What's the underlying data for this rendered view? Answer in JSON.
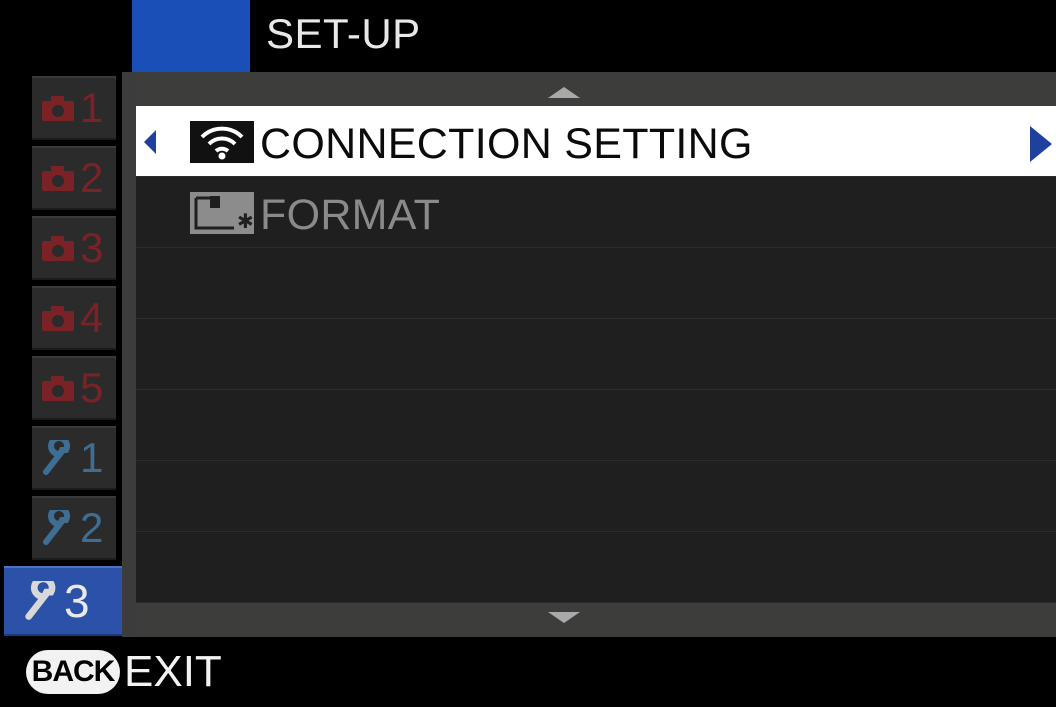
{
  "header": {
    "title": "SET-UP"
  },
  "sidebar": {
    "items": [
      {
        "icon": "camera-icon",
        "number": "1",
        "kind": "shooting"
      },
      {
        "icon": "camera-icon",
        "number": "2",
        "kind": "shooting"
      },
      {
        "icon": "camera-icon",
        "number": "3",
        "kind": "shooting"
      },
      {
        "icon": "camera-icon",
        "number": "4",
        "kind": "shooting"
      },
      {
        "icon": "camera-icon",
        "number": "5",
        "kind": "shooting"
      },
      {
        "icon": "wrench-icon",
        "number": "1",
        "kind": "setup"
      },
      {
        "icon": "wrench-icon",
        "number": "2",
        "kind": "setup"
      },
      {
        "icon": "wrench-icon",
        "number": "3",
        "kind": "setup",
        "active": true
      }
    ]
  },
  "menu": {
    "items": [
      {
        "label": "CONNECTION SETTING",
        "icon": "wifi-icon",
        "selected": true
      },
      {
        "label": "FORMAT",
        "icon": "format-card-icon",
        "selected": false
      }
    ]
  },
  "footer": {
    "back_label": "BACK",
    "exit_label": "EXIT"
  },
  "colors": {
    "accent_blue": "#1a4fb8",
    "active_tab": "#2b52a8",
    "shooting_red": "#7a2226",
    "setup_blue": "#3e6e93"
  }
}
